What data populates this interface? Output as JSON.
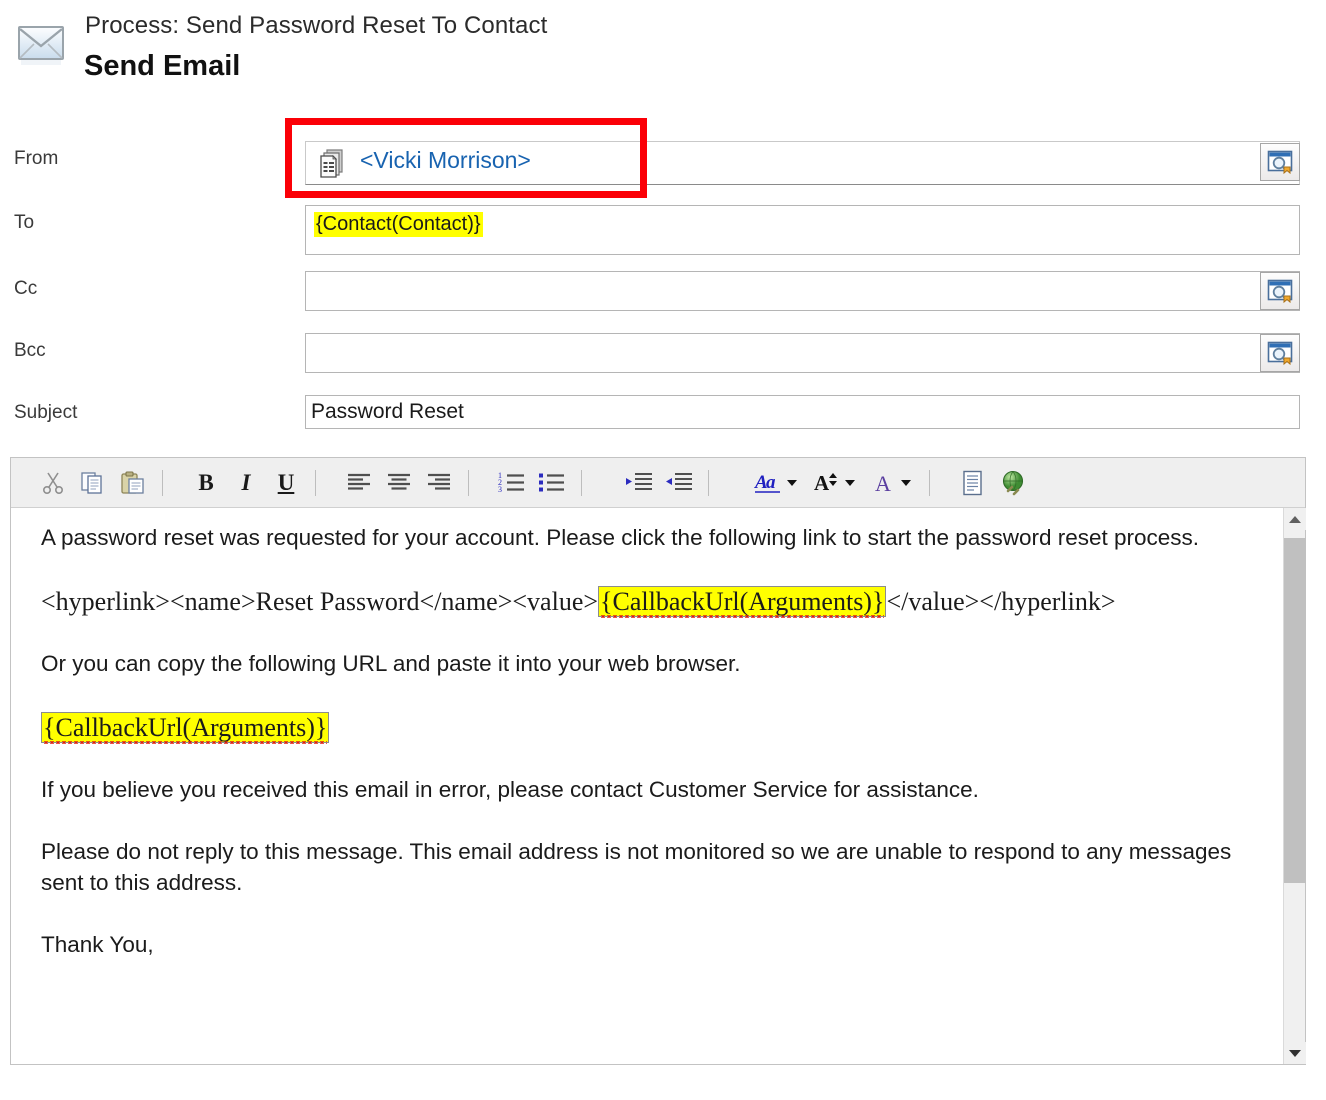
{
  "header": {
    "process_line": "Process: Send Password Reset To Contact",
    "title": "Send Email",
    "icon": "envelope-icon"
  },
  "form": {
    "from": {
      "label": "From",
      "value": "<Vicki Morrison>",
      "record_icon": "record-stack-icon",
      "lookup_icon": "lookup-window-icon",
      "highlight_color": "#fb0007",
      "value_color": "#1863b0"
    },
    "to": {
      "label": "To",
      "value": "{Contact(Contact)}",
      "highlight_color": "#ffff00"
    },
    "cc": {
      "label": "Cc",
      "value": "",
      "lookup_icon": "lookup-window-icon"
    },
    "bcc": {
      "label": "Bcc",
      "value": "",
      "lookup_icon": "lookup-window-icon"
    },
    "subject": {
      "label": "Subject",
      "value": "Password Reset"
    }
  },
  "toolbar": {
    "buttons": [
      {
        "name": "cut-icon",
        "tip": "Cut"
      },
      {
        "name": "copy-icon",
        "tip": "Copy"
      },
      {
        "name": "paste-icon",
        "tip": "Paste"
      },
      {
        "name": "bold-button",
        "label": "B",
        "tip": "Bold"
      },
      {
        "name": "italic-button",
        "label": "I",
        "tip": "Italic"
      },
      {
        "name": "underline-button",
        "label": "U",
        "tip": "Underline"
      },
      {
        "name": "align-left-icon",
        "tip": "Align Left"
      },
      {
        "name": "align-center-icon",
        "tip": "Align Center"
      },
      {
        "name": "align-right-icon",
        "tip": "Align Right"
      },
      {
        "name": "numbered-list-icon",
        "tip": "Numbered List"
      },
      {
        "name": "bulleted-list-icon",
        "tip": "Bulleted List"
      },
      {
        "name": "increase-indent-icon",
        "tip": "Increase Indent"
      },
      {
        "name": "decrease-indent-icon",
        "tip": "Decrease Indent"
      },
      {
        "name": "font-name-icon",
        "tip": "Font"
      },
      {
        "name": "font-size-icon",
        "tip": "Font Size"
      },
      {
        "name": "font-color-icon",
        "tip": "Font Color"
      },
      {
        "name": "insert-template-icon",
        "tip": "Insert Template"
      },
      {
        "name": "insert-hyperlink-icon",
        "tip": "Insert Hyperlink"
      }
    ]
  },
  "body": {
    "paragraphs": [
      {
        "style": "sans",
        "text": "A password reset was requested for your account. Please click the following link to start the password reset process."
      },
      {
        "style": "serif",
        "segments": [
          {
            "type": "plain",
            "text": "<hyperlink><name>Reset Password</name><value>"
          },
          {
            "type": "highlight",
            "text": "{CallbackUrl(Arguments)}"
          },
          {
            "type": "plain",
            "text": "</value></hyperlink>"
          }
        ]
      },
      {
        "style": "sans",
        "text": "Or you can copy the following URL and paste it into your web browser."
      },
      {
        "style": "serif",
        "segments": [
          {
            "type": "highlight",
            "text": "{CallbackUrl(Arguments)}"
          }
        ]
      },
      {
        "style": "sans",
        "text": "If you believe you received this email in error, please contact Customer Service for assistance."
      },
      {
        "style": "sans",
        "text": "Please do not reply to this message. This email address is not monitored so we are unable to respond to any messages sent to this address."
      },
      {
        "style": "sans",
        "text": "Thank You,"
      }
    ]
  },
  "scrollbar": {
    "up_arrow": "scroll-up-icon",
    "down_arrow": "scroll-down-icon",
    "thumb": "scroll-thumb"
  }
}
